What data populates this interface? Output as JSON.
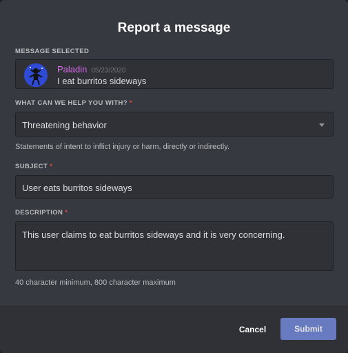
{
  "modal": {
    "title": "Report a message"
  },
  "message_section": {
    "label": "MESSAGE SELECTED",
    "author": "Paladin",
    "timestamp": "05/23/2020",
    "text": "I eat burritos sideways",
    "author_color": "#d66fe8"
  },
  "category": {
    "label": "WHAT CAN WE HELP YOU WITH?",
    "selected": "Threatening behavior",
    "help": "Statements of intent to inflict injury or harm, directly or indirectly."
  },
  "subject": {
    "label": "SUBJECT",
    "value": "User eats burritos sideways"
  },
  "description": {
    "label": "DESCRIPTION",
    "value": "This user claims to eat burritos sideways and it is very concerning.",
    "hint": "40 character minimum, 800 character maximum"
  },
  "required_marker": "*",
  "footer": {
    "cancel_label": "Cancel",
    "submit_label": "Submit"
  },
  "colors": {
    "accent": "#7289da",
    "required": "#ed4245",
    "background": "#36393f"
  }
}
